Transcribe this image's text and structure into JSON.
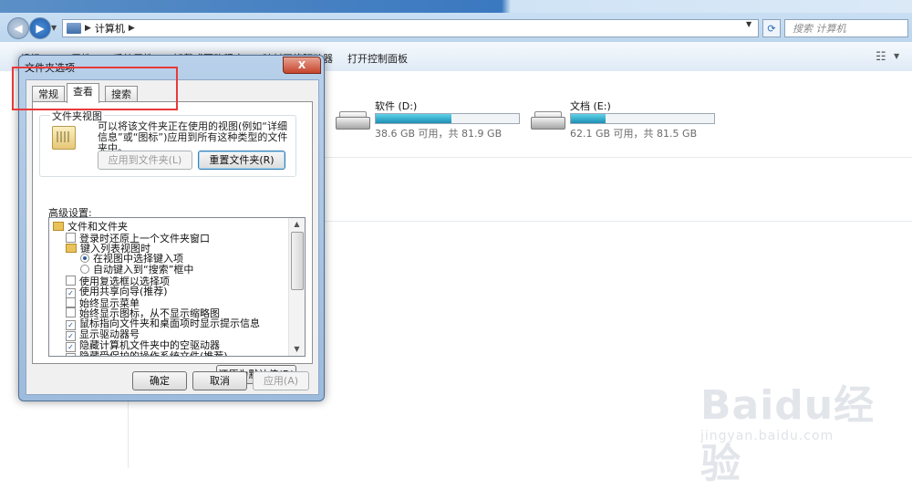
{
  "explorer": {
    "address_crumb": "计算机",
    "search_placeholder": "搜索 计算机",
    "toolbar": {
      "organize": "组织",
      "properties": "属性",
      "system_properties": "系统属性",
      "uninstall": "卸载或更改程序",
      "map_drive": "映射网络驱动器",
      "control_panel": "打开控制面板"
    },
    "drives": [
      {
        "name": "软件 (D:)",
        "size": "38.6 GB 可用，共 81.9 GB",
        "used_fraction": 0.53
      },
      {
        "name": "文档 (E:)",
        "size": "62.1 GB 可用，共 81.5 GB",
        "used_fraction": 0.24
      }
    ]
  },
  "dialog": {
    "title": "文件夹选项",
    "close_glyph": "X",
    "tabs": [
      "常规",
      "查看",
      "搜索"
    ],
    "active_tab": "查看",
    "folder_views": {
      "label": "文件夹视图",
      "description": "可以将该文件夹正在使用的视图(例如“详细信息”或“图标”)应用到所有这种类型的文件夹中。",
      "apply_button": "应用到文件夹(L)",
      "reset_button": "重置文件夹(R)"
    },
    "advanced": {
      "label": "高级设置:",
      "items": [
        {
          "type": "folder",
          "text": "文件和文件夹",
          "checked": false,
          "indent": 0
        },
        {
          "type": "checkbox",
          "text": "登录时还原上一个文件夹窗口",
          "checked": false,
          "indent": 1
        },
        {
          "type": "folder",
          "text": "键入列表视图时",
          "checked": false,
          "indent": 1
        },
        {
          "type": "radio",
          "text": "在视图中选择键入项",
          "checked": true,
          "indent": 2
        },
        {
          "type": "radio",
          "text": "自动键入到“搜索”框中",
          "checked": false,
          "indent": 2
        },
        {
          "type": "checkbox",
          "text": "使用复选框以选择项",
          "checked": false,
          "indent": 1
        },
        {
          "type": "checkbox",
          "text": "使用共享向导(推荐)",
          "checked": true,
          "indent": 1
        },
        {
          "type": "checkbox",
          "text": "始终显示菜单",
          "checked": false,
          "indent": 1
        },
        {
          "type": "checkbox",
          "text": "始终显示图标，从不显示缩略图",
          "checked": false,
          "indent": 1
        },
        {
          "type": "checkbox",
          "text": "鼠标指向文件夹和桌面项时显示提示信息",
          "checked": true,
          "indent": 1
        },
        {
          "type": "checkbox",
          "text": "显示驱动器号",
          "checked": true,
          "indent": 1
        },
        {
          "type": "checkbox",
          "text": "隐藏计算机文件夹中的空驱动器",
          "checked": true,
          "indent": 1
        },
        {
          "type": "checkbox",
          "text": "隐藏受保护的操作系统文件(推荐)",
          "checked": true,
          "indent": 1
        }
      ],
      "restore_button": "还原为默认值(D)"
    },
    "ok_button": "确定",
    "cancel_button": "取消",
    "apply_button": "应用(A)"
  },
  "watermark": {
    "logo": "Baidu经验",
    "url": "jingyan.baidu.com"
  },
  "colors": {
    "highlight": "#e83a3a",
    "drive_bar": "#1c8fb6"
  }
}
